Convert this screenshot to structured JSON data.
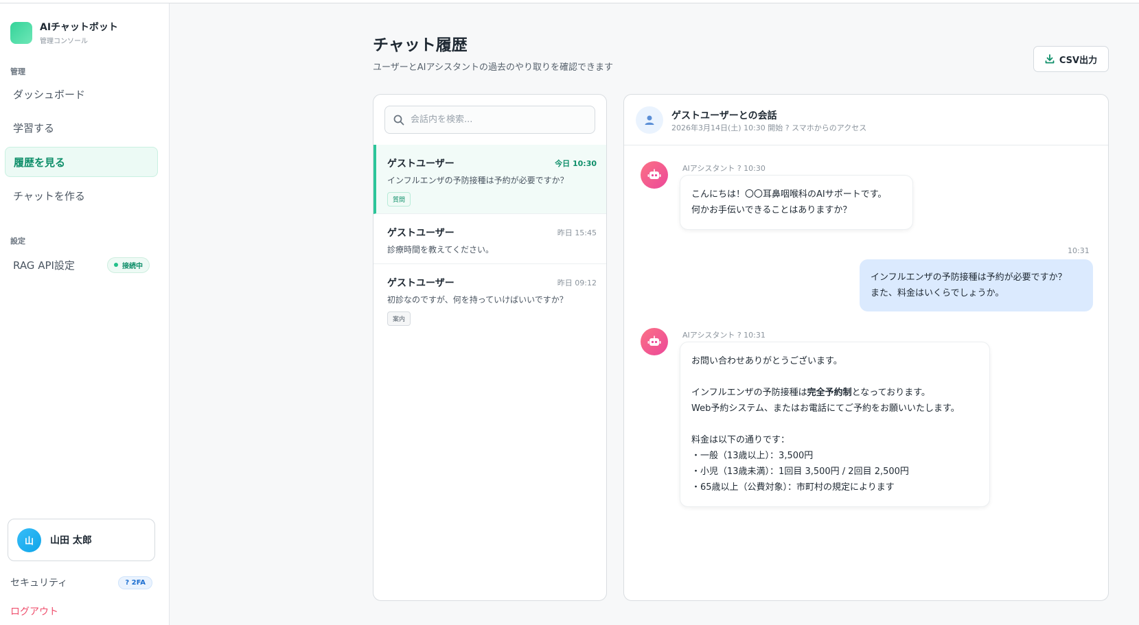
{
  "app": {
    "title": "AIチャットボット",
    "subtitle": "管理コンソール"
  },
  "sidebar": {
    "section_manage": "管理",
    "items": [
      {
        "label": "ダッシュボード"
      },
      {
        "label": "学習する"
      },
      {
        "label": "履歴を見る",
        "active": true
      },
      {
        "label": "チャットを作る"
      }
    ],
    "section_settings": "設定",
    "rag": {
      "label": "RAG API設定",
      "status": "接続中"
    },
    "user": {
      "initial": "山",
      "name": "山田 太郎"
    },
    "security": {
      "label": "セキュリティ",
      "badge": "? 2FA"
    },
    "logout": "ログアウト"
  },
  "header": {
    "title": "チャット履歴",
    "subtitle": "ユーザーとAIアシスタントの過去のやり取りを確認できます",
    "csv_label": "CSV出力"
  },
  "search": {
    "placeholder": "会話内を検索..."
  },
  "conversations": [
    {
      "name": "ゲストユーザー",
      "time": "今日 10:30",
      "preview": "インフルエンザの予防接種は予約が必要ですか？",
      "tag": "質問"
    },
    {
      "name": "ゲストユーザー",
      "time": "昨日 15:45",
      "preview": "診療時間を教えてください。"
    },
    {
      "name": "ゲストユーザー",
      "time": "昨日 09:12",
      "preview": "初診なのですが、何を持っていけばいいですか？",
      "tag": "案内"
    }
  ],
  "chat": {
    "title": "ゲストユーザーとの会話",
    "meta": "2026年3月14日(土) 10:30 開始 ? スマホからのアクセス",
    "messages": [
      {
        "role": "ai",
        "meta": "AIアシスタント ? 10:30",
        "lines": [
          "こんにちは！〇〇耳鼻咽喉科のAIサポートです。",
          "何かお手伝いできることはありますか？"
        ]
      },
      {
        "role": "user",
        "meta": "10:31",
        "lines": [
          "インフルエンザの予防接種は予約が必要ですか？",
          "また、料金はいくらでしょうか。"
        ]
      },
      {
        "role": "ai",
        "meta": "AIアシスタント ? 10:31",
        "line1": "お問い合わせありがとうございます。",
        "line2_pre": "インフルエンザの予防接種は",
        "line2_bold": "完全予約制",
        "line2_post": "となっております。",
        "line3": "Web予約システム、またはお電話にてご予約をお願いいたします。",
        "line4": "料金は以下の通りです：",
        "line5": "・一般（13歳以上）：3,500円",
        "line6": "・小児（13歳未満）：1回目 3,500円 / 2回目 2,500円",
        "line7": "・65歳以上（公費対象）：市町村の規定によります"
      }
    ]
  },
  "colors": {
    "accent": "#2cc59a",
    "user_bubble": "#dbeafe",
    "logout": "#ef4f6d"
  }
}
